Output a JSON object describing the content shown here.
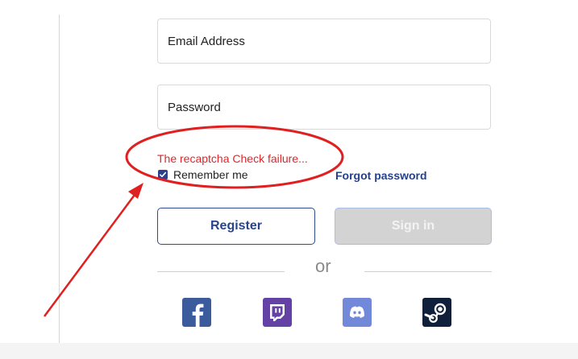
{
  "form": {
    "email_label": "Email Address",
    "password_label": "Password",
    "error_message": "The recaptcha Check failure...",
    "remember_label": "Remember me",
    "remember_checked": true,
    "forgot_label": "Forgot password",
    "register_label": "Register",
    "signin_label": "Sign in",
    "divider_label": "or"
  },
  "social": [
    {
      "name": "facebook-icon",
      "color": "#3b5b9d"
    },
    {
      "name": "twitch-icon",
      "color": "#6441a5"
    },
    {
      "name": "discord-icon",
      "color": "#7289da"
    },
    {
      "name": "steam-icon",
      "color": "#10203a"
    }
  ],
  "colors": {
    "accent": "#27448d",
    "error": "#e0262a",
    "annotation": "#e02020"
  }
}
